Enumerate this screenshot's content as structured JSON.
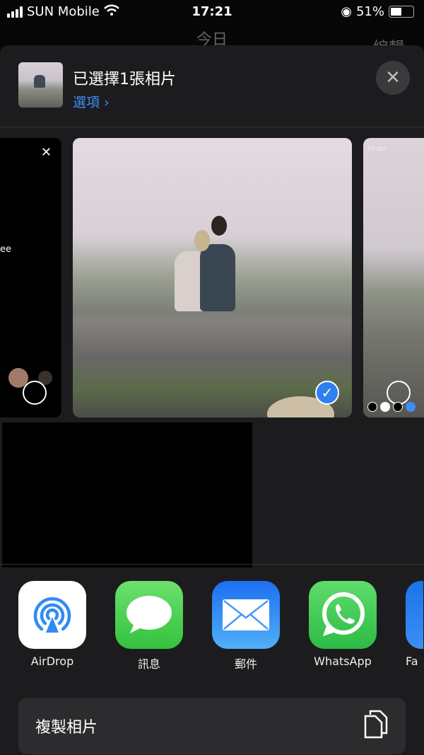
{
  "status_bar": {
    "carrier": "SUN Mobile",
    "time": "17:21",
    "battery": "51%",
    "battery_level": 51
  },
  "background_nav": {
    "title": "今日",
    "right": "編輯"
  },
  "sheet": {
    "title": "已選擇1張相片",
    "options_label": "選項",
    "preview_cards": [
      {
        "text": "ee"
      },
      {
        "selected": true
      },
      {
        "text": "Undo"
      }
    ],
    "apps": [
      {
        "label": "AirDrop",
        "icon": "airdrop-icon",
        "color": "#ffffff"
      },
      {
        "label": "訊息",
        "icon": "messages-icon",
        "color": "#4cd964"
      },
      {
        "label": "郵件",
        "icon": "mail-icon",
        "color": "#2f8cf5"
      },
      {
        "label": "WhatsApp",
        "icon": "whatsapp-icon",
        "color": "#3ec34f"
      },
      {
        "label": "Fa",
        "icon": "facebook-icon",
        "color": "#1877f2"
      }
    ],
    "action": {
      "label": "複製相片",
      "icon": "copy-icon"
    }
  }
}
